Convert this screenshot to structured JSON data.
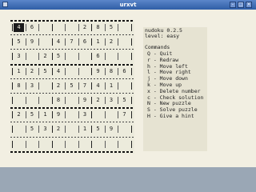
{
  "window": {
    "title": "urxvt",
    "buttons": [
      "-",
      "□",
      "×"
    ]
  },
  "app": {
    "name_version": "nudoku 0.2.5",
    "level_line": "level: easy"
  },
  "board": {
    "selected": [
      0,
      0
    ],
    "rows": [
      [
        "4",
        "6",
        "",
        "",
        "",
        "2",
        "8",
        "5",
        ""
      ],
      [
        "5",
        "9",
        "",
        "4",
        "7",
        "6",
        "1",
        "2",
        ""
      ],
      [
        "3",
        "",
        "2",
        "5",
        "",
        "",
        "6",
        "",
        ""
      ],
      [
        "1",
        "2",
        "5",
        "4",
        "",
        "",
        "9",
        "8",
        "6"
      ],
      [
        "8",
        "3",
        "",
        "2",
        "5",
        "7",
        "4",
        "1",
        ""
      ],
      [
        "",
        "",
        "",
        "8",
        "",
        "9",
        "2",
        "3",
        "5"
      ],
      [
        "2",
        "5",
        "1",
        "9",
        "",
        "3",
        "",
        "",
        "7"
      ],
      [
        "",
        "5",
        "3",
        "2",
        "",
        "1",
        "5",
        "9",
        ""
      ],
      [
        "",
        "",
        "",
        "",
        "",
        "",
        "",
        "",
        ""
      ]
    ]
  },
  "commands": {
    "heading": "Commands",
    "items": [
      "Q - Quit",
      "r - Redraw",
      "h - Move left",
      "l - Move right",
      "j - Move down",
      "k - Move up",
      "x - Delete number",
      "c - Check solution",
      "N - New puzzle",
      "S - Solve puzzle",
      "H - Give a hint"
    ]
  }
}
